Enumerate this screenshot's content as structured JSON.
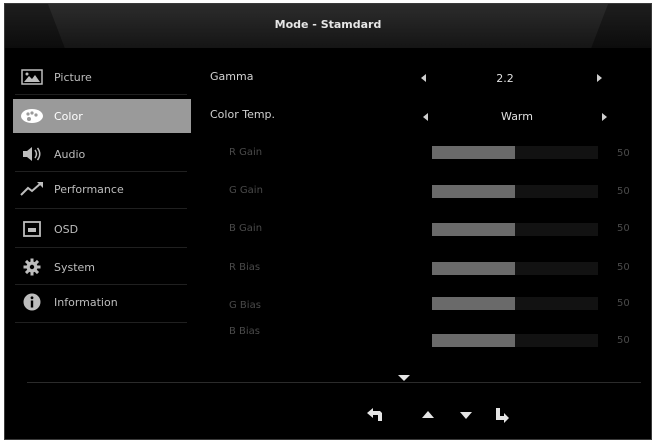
{
  "title": "Mode - Stamdard",
  "sidebar": {
    "items": [
      {
        "label": "Picture",
        "icon": "picture-icon"
      },
      {
        "label": "Color",
        "icon": "color-palette-icon",
        "active": true
      },
      {
        "label": "Audio",
        "icon": "speaker-icon"
      },
      {
        "label": "Performance",
        "icon": "performance-chart-icon"
      },
      {
        "label": "OSD",
        "icon": "osd-window-icon"
      },
      {
        "label": "System",
        "icon": "gear-icon"
      },
      {
        "label": "Information",
        "icon": "info-icon"
      }
    ]
  },
  "settings": {
    "gamma": {
      "label": "Gamma",
      "value": "2.2"
    },
    "color_temp": {
      "label": "Color Temp.",
      "value": "Warm"
    },
    "sliders": [
      {
        "label": "R Gain",
        "value": 50,
        "display": "50"
      },
      {
        "label": "G Gain",
        "value": 50,
        "display": "50"
      },
      {
        "label": "B Gain",
        "value": 50,
        "display": "50"
      },
      {
        "label": "R Bias",
        "value": 50,
        "display": "50"
      },
      {
        "label": "G Bias",
        "value": 50,
        "display": "50"
      },
      {
        "label": "B Bias",
        "value": 50,
        "display": "50"
      }
    ]
  },
  "nav": [
    "back-icon",
    "up-icon",
    "down-icon",
    "enter-icon"
  ],
  "colors": {
    "active_item": "#9a9a9a",
    "slider_fill": "#6a6a6a",
    "background": "#000000"
  }
}
